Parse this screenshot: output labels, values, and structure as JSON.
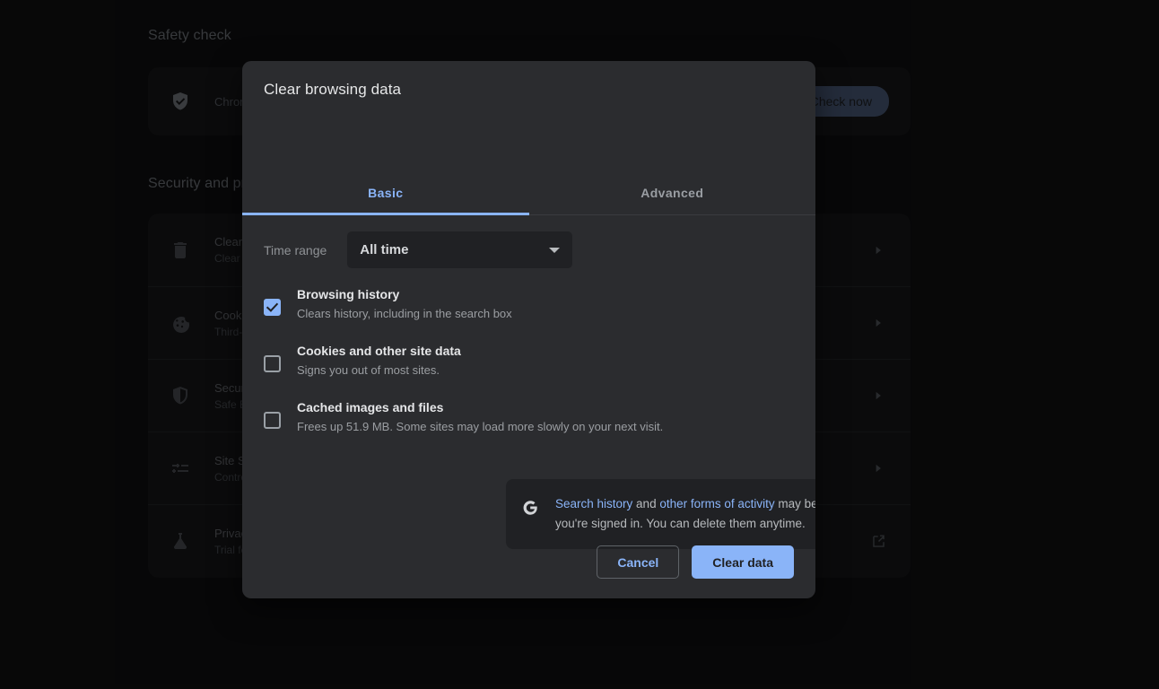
{
  "background": {
    "safety_heading": "Safety check",
    "safety_card": {
      "icon": "shield-check-icon",
      "text": "Chrome can help keep you safe from data breaches, bad extensions, and more",
      "button_label": "Check now"
    },
    "security_heading": "Security and privacy",
    "security_rows": [
      {
        "icon": "trash-icon",
        "title": "Clear browsing data",
        "subtitle": "Clear history, cookies, cache, and more",
        "trailing": "chevron-right-icon"
      },
      {
        "icon": "cookie-icon",
        "title": "Cookies and other site data",
        "subtitle": "Third-party cookies are blocked in Incognito mode",
        "trailing": "chevron-right-icon"
      },
      {
        "icon": "shield-icon",
        "title": "Security",
        "subtitle": "Safe Browsing (protection from dangerous sites) and other security settings",
        "trailing": "chevron-right-icon"
      },
      {
        "icon": "sliders-icon",
        "title": "Site Settings",
        "subtitle": "Controls what information sites can use and show (location, camera, pop-ups, and more)",
        "trailing": "chevron-right-icon"
      },
      {
        "icon": "flask-icon",
        "title": "Privacy Sandbox",
        "subtitle": "Trial features are on",
        "trailing": "external-link-icon"
      }
    ]
  },
  "dialog": {
    "title": "Clear browsing data",
    "tabs": [
      {
        "label": "Basic",
        "active": true
      },
      {
        "label": "Advanced",
        "active": false
      }
    ],
    "time_range": {
      "label": "Time range",
      "value": "All time",
      "caret": "chevron-down-icon"
    },
    "options": [
      {
        "title": "Browsing history",
        "description": "Clears history, including in the search box",
        "checked": true
      },
      {
        "title": "Cookies and other site data",
        "description": "Signs you out of most sites.",
        "checked": false
      },
      {
        "title": "Cached images and files",
        "description": "Frees up 51.9 MB. Some sites may load more slowly on your next visit.",
        "checked": false
      }
    ],
    "google_note": {
      "icon": "google-g-icon",
      "link1": "Search history",
      "mid": " and ",
      "link2": "other forms of activity",
      "tail": " may be saved in your Google Account when you're signed in. You can delete them anytime."
    },
    "cancel_label": "Cancel",
    "confirm_label": "Clear data"
  },
  "colors": {
    "accent": "#8ab4f8",
    "dialog_bg": "#2b2c2f",
    "page_bg": "#0d0d0e",
    "card_bg": "#131314",
    "field_bg": "#202124"
  }
}
